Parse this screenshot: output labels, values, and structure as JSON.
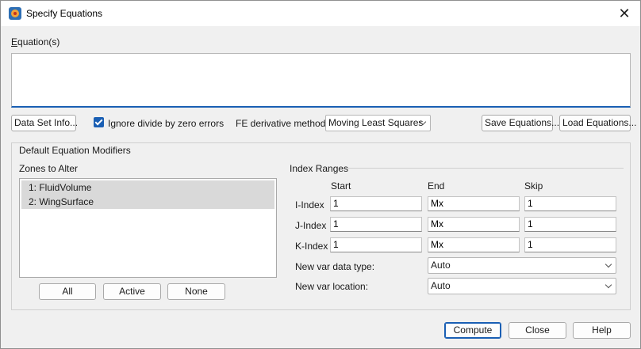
{
  "window": {
    "title": "Specify Equations",
    "close_glyph": "✕"
  },
  "equations": {
    "label": "Equation(s)",
    "value": ""
  },
  "toolbar": {
    "data_set_info": "Data Set Info...",
    "ignore_divide_label": "Ignore divide by zero errors",
    "ignore_divide_checked": true,
    "fe_method_label": "FE derivative method:",
    "fe_method_value": "Moving Least Squares",
    "save_equations": "Save Equations...",
    "load_equations": "Load Equations..."
  },
  "modifiers": {
    "title": "Default Equation Modifiers",
    "zones_label": "Zones to Alter",
    "zones": [
      "1: FluidVolume",
      "2: WingSurface"
    ],
    "zone_buttons": {
      "all": "All",
      "active": "Active",
      "none": "None"
    },
    "index_ranges": {
      "title": "Index Ranges",
      "headers": {
        "start": "Start",
        "end": "End",
        "skip": "Skip"
      },
      "rows": [
        {
          "label": "I-Index",
          "start": "1",
          "end": "Mx",
          "skip": "1"
        },
        {
          "label": "J-Index",
          "start": "1",
          "end": "Mx",
          "skip": "1"
        },
        {
          "label": "K-Index",
          "start": "1",
          "end": "Mx",
          "skip": "1"
        }
      ]
    },
    "new_var_type_label": "New var data type:",
    "new_var_type_value": "Auto",
    "new_var_location_label": "New var location:",
    "new_var_location_value": "Auto"
  },
  "footer": {
    "compute": "Compute",
    "close": "Close",
    "help": "Help"
  }
}
